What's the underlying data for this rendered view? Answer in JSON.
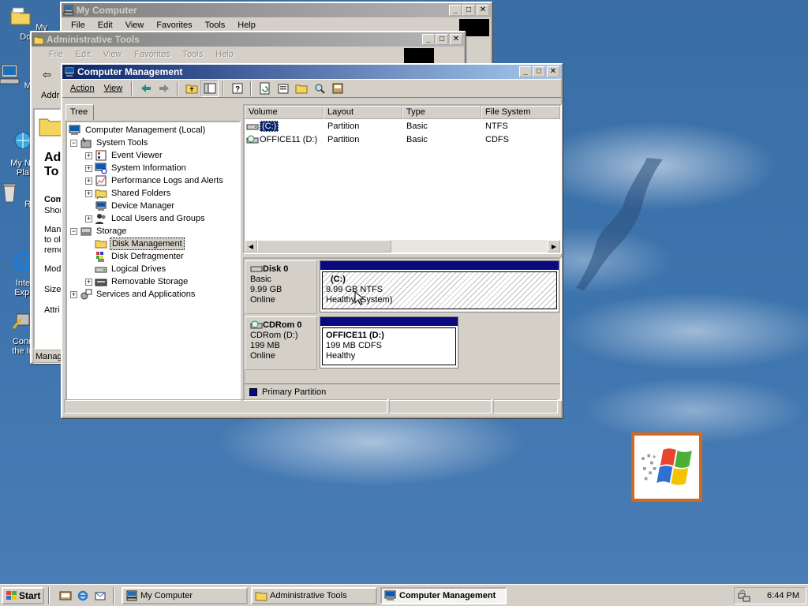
{
  "desktop": {
    "icons": [
      {
        "label": "My Doc",
        "name": "my-documents"
      },
      {
        "label": "My Co",
        "name": "my-computer"
      },
      {
        "label": "My Ne\nPla",
        "name": "my-network-places"
      },
      {
        "label": "Recyc",
        "name": "recycle-bin"
      },
      {
        "label": "Inte\nExpl",
        "name": "internet-explorer"
      },
      {
        "label": "Conn\nthe In",
        "name": "connect-to-internet"
      }
    ]
  },
  "my_computer": {
    "title": "My Computer",
    "menu": [
      "File",
      "Edit",
      "View",
      "Favorites",
      "Tools",
      "Help"
    ]
  },
  "admin_tools": {
    "title": "Administrative Tools",
    "menu": [
      "File",
      "Edit",
      "View",
      "Favorites",
      "Tools",
      "Help"
    ],
    "side_title": "Adm\nTo",
    "side_heading": "Com",
    "side_sub": "Shor",
    "side_desc": "Man\nto ol\nremo",
    "side_modified": "Modi",
    "side_size": "Size:",
    "side_attr": "Attri",
    "addr": "Addr",
    "status": "Manag"
  },
  "computer_management": {
    "title": "Computer Management",
    "toolbar": {
      "action": "Action",
      "view": "View"
    },
    "tree_tab": "Tree",
    "tree": [
      {
        "label": "Computer Management (Local)",
        "level": 0,
        "exp": "",
        "icon": "computer-management-icon"
      },
      {
        "label": "System Tools",
        "level": 1,
        "exp": "-",
        "icon": "system-tools-icon"
      },
      {
        "label": "Event Viewer",
        "level": 2,
        "exp": "+",
        "icon": "event-viewer-icon"
      },
      {
        "label": "System Information",
        "level": 2,
        "exp": "+",
        "icon": "system-information-icon"
      },
      {
        "label": "Performance Logs and Alerts",
        "level": 2,
        "exp": "+",
        "icon": "performance-logs-icon"
      },
      {
        "label": "Shared Folders",
        "level": 2,
        "exp": "+",
        "icon": "shared-folders-icon"
      },
      {
        "label": "Device Manager",
        "level": 2,
        "exp": "",
        "icon": "device-manager-icon"
      },
      {
        "label": "Local Users and Groups",
        "level": 2,
        "exp": "+",
        "icon": "local-users-icon"
      },
      {
        "label": "Storage",
        "level": 1,
        "exp": "-",
        "icon": "storage-icon"
      },
      {
        "label": "Disk Management",
        "level": 2,
        "exp": "",
        "icon": "disk-management-icon",
        "selected": true
      },
      {
        "label": "Disk Defragmenter",
        "level": 2,
        "exp": "",
        "icon": "disk-defragmenter-icon"
      },
      {
        "label": "Logical Drives",
        "level": 2,
        "exp": "",
        "icon": "logical-drives-icon"
      },
      {
        "label": "Removable Storage",
        "level": 2,
        "exp": "+",
        "icon": "removable-storage-icon"
      },
      {
        "label": "Services and Applications",
        "level": 1,
        "exp": "+",
        "icon": "services-applications-icon"
      }
    ],
    "list_columns": [
      "Volume",
      "Layout",
      "Type",
      "File System"
    ],
    "volumes": [
      {
        "volume": "(C:)",
        "layout": "Partition",
        "type": "Basic",
        "fs": "NTFS"
      },
      {
        "volume": "OFFICE11 (D:)",
        "layout": "Partition",
        "type": "Basic",
        "fs": "CDFS"
      }
    ],
    "disks": [
      {
        "name": "Disk 0",
        "kind": "Basic",
        "size": "9.99 GB",
        "state": "Online",
        "partition": {
          "label": "(C:)",
          "detail": "9.99 GB NTFS",
          "status": "Healthy (System)"
        }
      },
      {
        "name": "CDRom 0",
        "kind": "CDRom (D:)",
        "size": "199 MB",
        "state": "Online",
        "partition": {
          "label": "OFFICE11  (D:)",
          "detail": "199 MB CDFS",
          "status": "Healthy"
        }
      }
    ],
    "legend": "Primary Partition"
  },
  "taskbar": {
    "start": "Start",
    "tasks": [
      "My Computer",
      "Administrative Tools",
      "Computer Management"
    ],
    "time": "6:44 PM"
  },
  "colors": {
    "accent": "#0a246a",
    "desktop": "#3a6ea5",
    "partition_bar": "#0a0a80"
  }
}
